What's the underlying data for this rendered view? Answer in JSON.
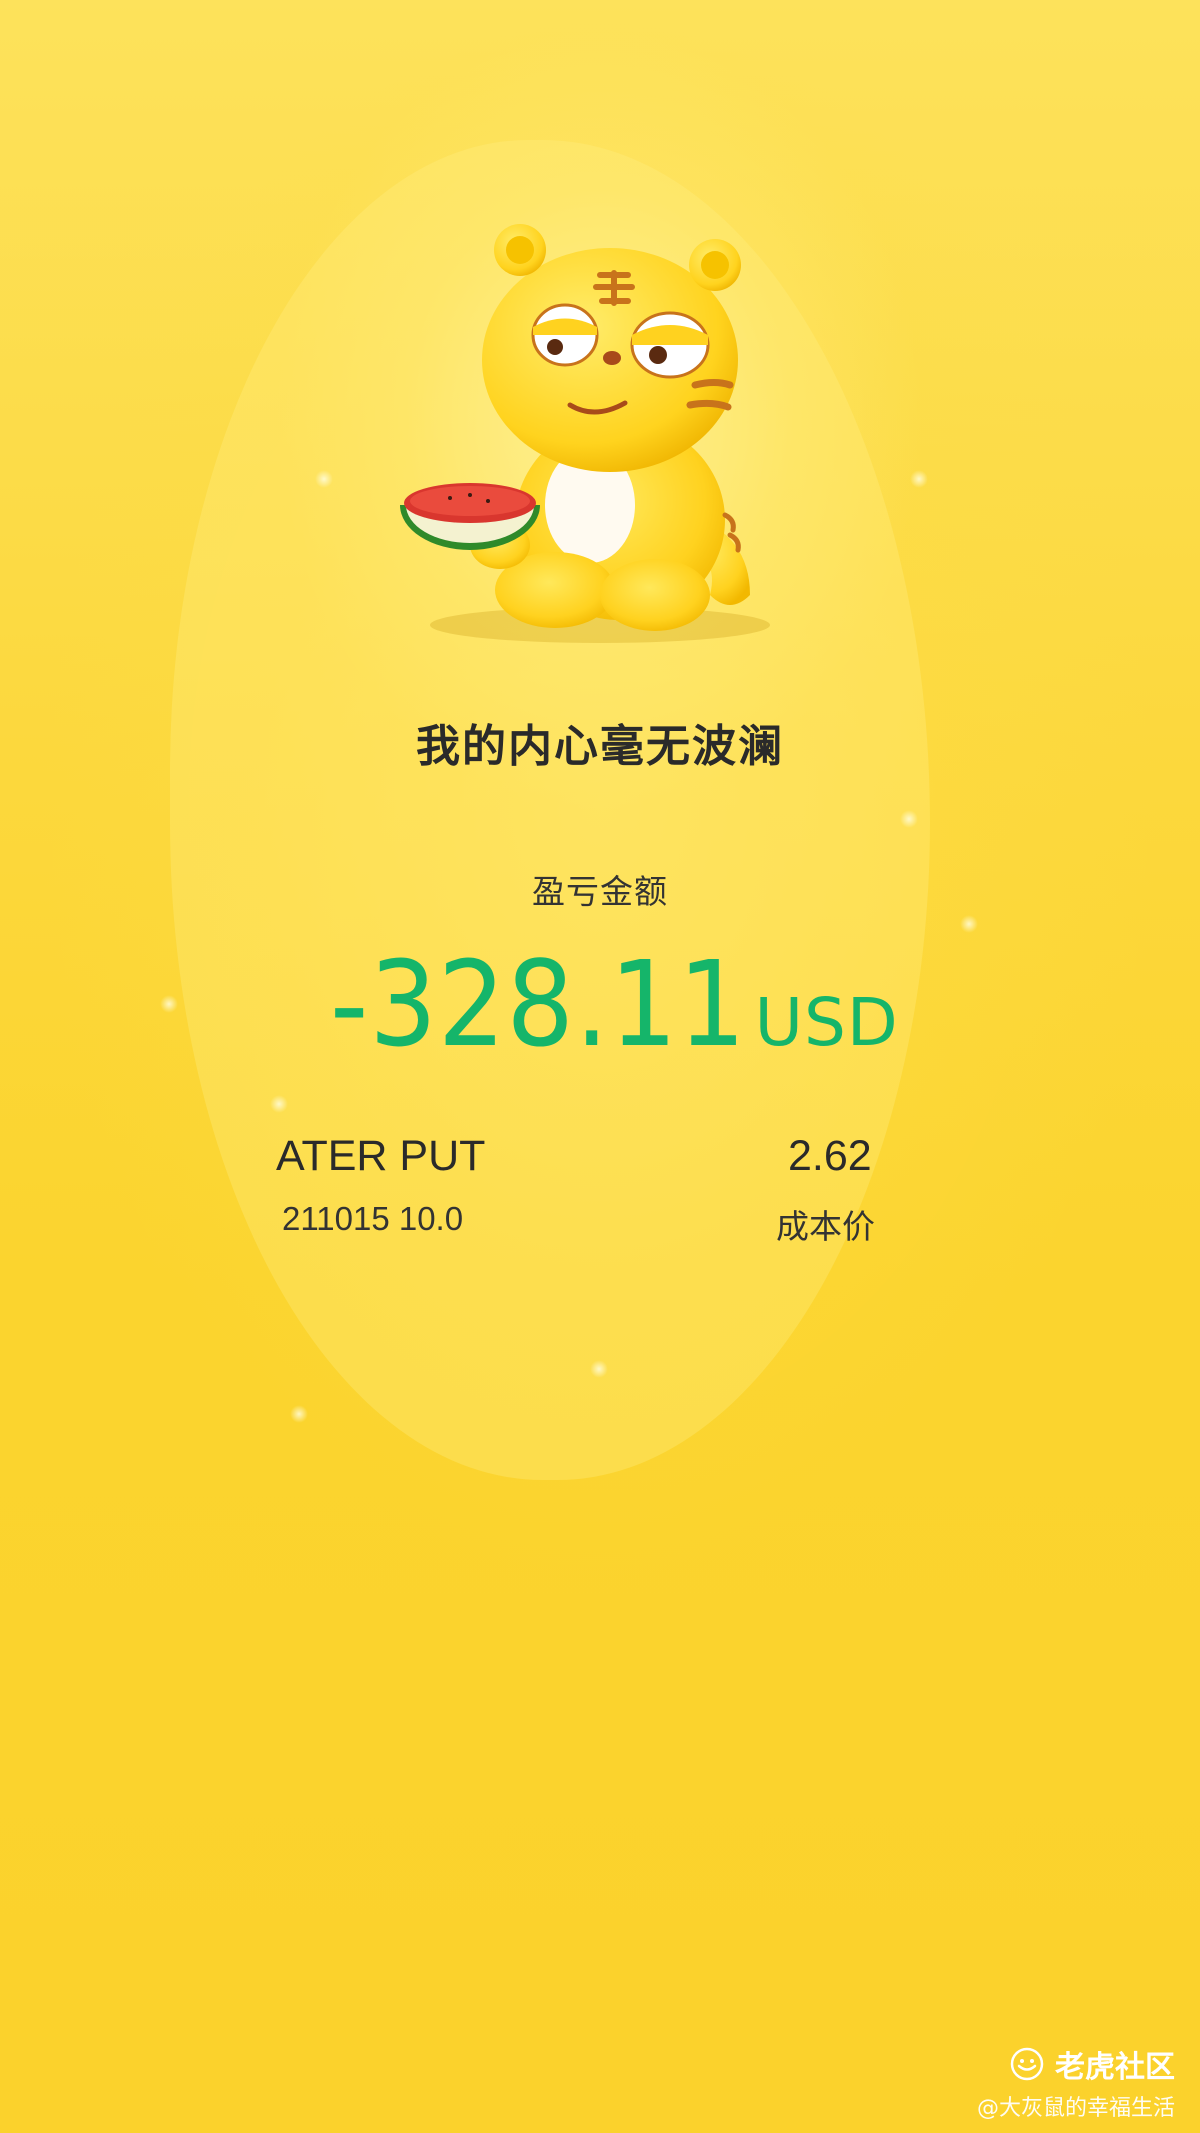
{
  "headline": "我的内心毫无波澜",
  "pnl": {
    "label": "盈亏金额",
    "value": "-328.11",
    "unit": "USD",
    "color": "#15b56a"
  },
  "contract": {
    "name": "ATER PUT",
    "detail": "211015 10.0"
  },
  "cost": {
    "value": "2.62",
    "label": "成本价"
  },
  "brand": {
    "name": "老虎社区",
    "icon": "tiger-logo-icon"
  },
  "watermark": "@大灰鼠的幸福生活",
  "mascot": {
    "icon": "tiger-mascot-with-watermelon"
  }
}
